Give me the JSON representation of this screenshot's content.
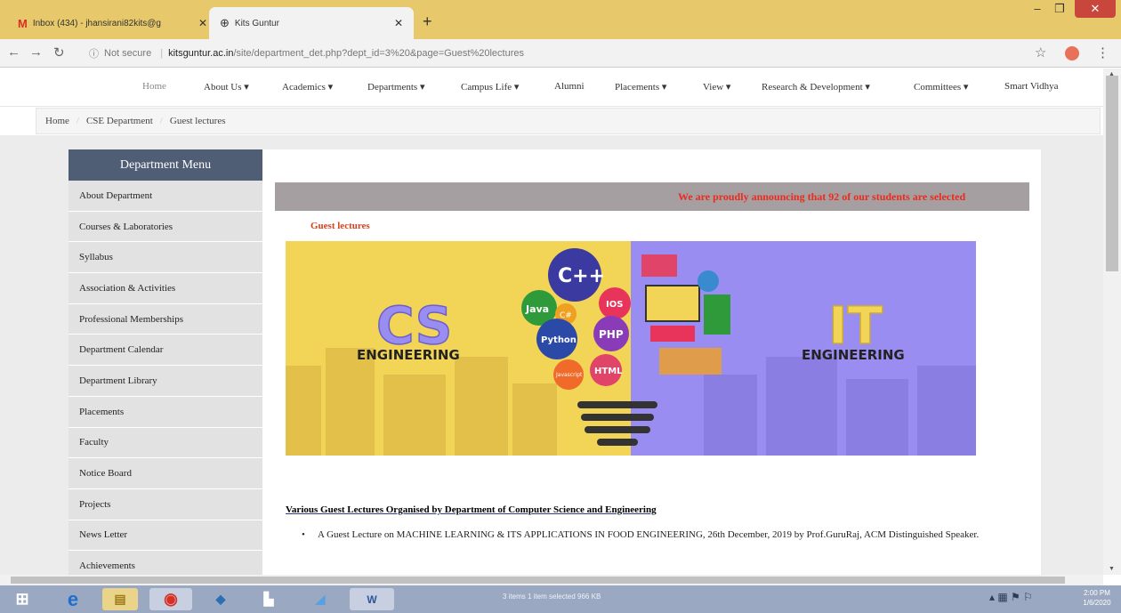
{
  "browser": {
    "tabs": [
      {
        "label": "Inbox (434) - jhansirani82kits@g",
        "icon": "gmail-icon"
      },
      {
        "label": "Kits Guntur",
        "icon": "globe-icon"
      }
    ],
    "new_tab": "+",
    "controls": {
      "minimize": "–",
      "maximize": "❐",
      "close": "✕"
    },
    "address": {
      "security": "Not secure",
      "host": "kitsguntur.ac.in",
      "path": "/site/department_det.php?dept_id=3%20&page=Guest%20lectures"
    }
  },
  "site_nav": [
    "Home",
    "About Us ▾",
    "Academics ▾",
    "Departments ▾",
    "Campus Life ▾",
    "Alumni",
    "Placements ▾",
    "View ▾",
    "Research & Development ▾",
    "Committees ▾",
    "Smart Vidhya"
  ],
  "breadcrumb": [
    "Home",
    "CSE Department",
    "Guest lectures"
  ],
  "sidebar": {
    "title": "Department Menu",
    "items": [
      "About Department",
      "Courses & Laboratories",
      "Syllabus",
      "Association & Activities",
      "Professional Memberships",
      "Department Calendar",
      "Department Library",
      "Placements",
      "Faculty",
      "Notice Board",
      "Projects",
      "News Letter",
      "Achievements"
    ]
  },
  "main": {
    "marquee": "We are proudly announcing that 92 of our students are selected",
    "heading": "Guest lectures",
    "banner": {
      "left_big": "CS",
      "left_small": "ENGINEERING",
      "right_big": "IT",
      "right_small": "ENGINEERING",
      "bubbles": [
        "C++",
        "Java",
        "C#",
        "IOS",
        "Python",
        "PHP",
        "HTML",
        "Javascript"
      ]
    },
    "section_title": "Various Guest Lectures Organised by Department of Computer Science and Engineering",
    "lectures": [
      "A Guest Lecture on MACHINE LEARNING & ITS APPLICATIONS IN FOOD ENGINEERING, 26th December, 2019 by Prof.GuruRaj, ACM Distinguished Speaker."
    ]
  },
  "taskbar": {
    "status": "3 items    1 item selected  966 KB",
    "time": "2:00 PM",
    "date": "1/6/2020"
  }
}
